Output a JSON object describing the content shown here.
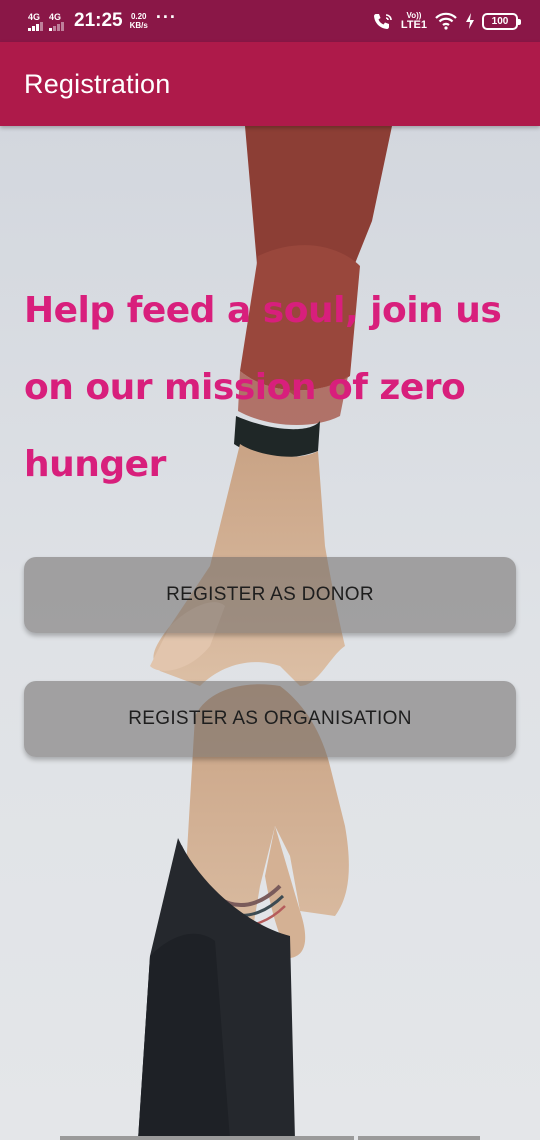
{
  "status_bar": {
    "sim1_label": "4G",
    "sim2_label": "4G",
    "time": "21:25",
    "speed_value": "0.20",
    "speed_unit": "KB/s",
    "more": "···",
    "volte_top": "Vo))",
    "volte_bottom": "LTE1",
    "battery": "100",
    "icons": [
      "signal-icon",
      "signal-icon",
      "wifi-calling-icon",
      "wifi-icon",
      "charging-icon",
      "battery-icon"
    ]
  },
  "app_bar": {
    "title": "Registration"
  },
  "main": {
    "headline": "Help feed a soul, join us on our mission of zero hunger",
    "register_donor_label": "REGISTER AS DONOR",
    "register_org_label": "REGISTER AS ORGANISATION"
  },
  "colors": {
    "status_bar": "#8a1747",
    "app_bar": "#ae1a4a",
    "headline": "#d81f7c",
    "background": "#d9dde2"
  }
}
